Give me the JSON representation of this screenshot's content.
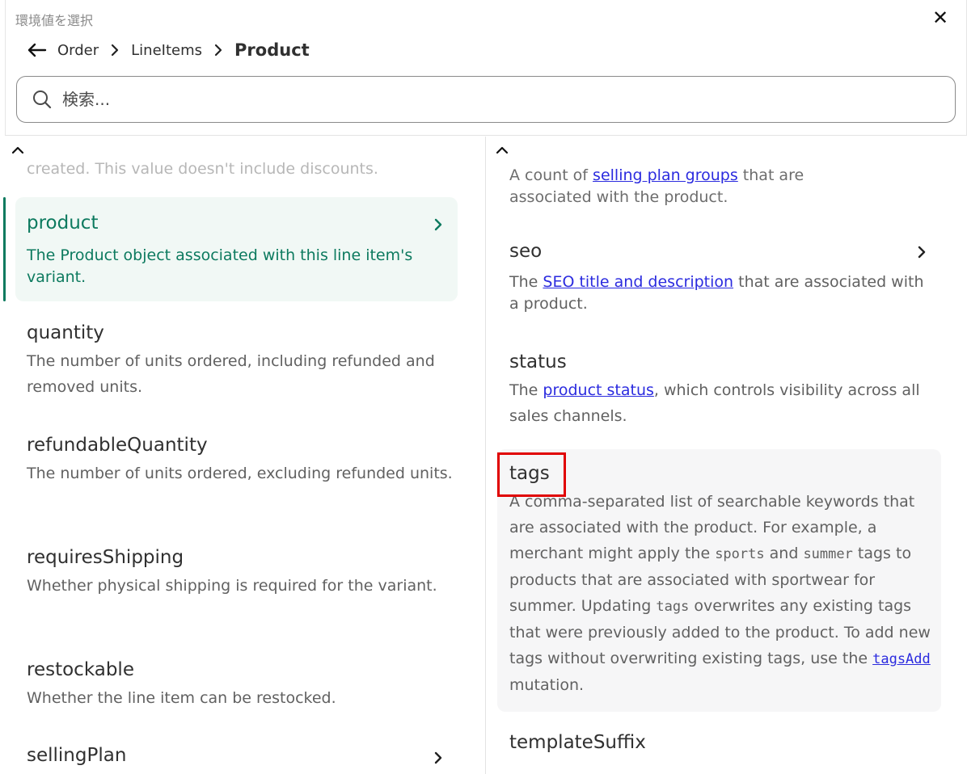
{
  "dialog": {
    "title": "環境値を選択",
    "close_label": "✕"
  },
  "breadcrumb": {
    "items": [
      "Order",
      "LineItems"
    ],
    "current": "Product"
  },
  "search": {
    "placeholder": "検索..."
  },
  "left": {
    "faded_top": "created. This value doesn't include discounts.",
    "items": [
      {
        "name": "product",
        "desc": "The Product object associated with this line item's variant.",
        "selected": true,
        "has_children": true
      },
      {
        "name": "quantity",
        "desc": "The number of units ordered, including refunded and removed units."
      },
      {
        "name": "refundableQuantity",
        "desc": "The number of units ordered, excluding refunded units."
      },
      {
        "name": "requiresShipping",
        "desc": "Whether physical shipping is required for the variant."
      },
      {
        "name": "restockable",
        "desc": "Whether the line item can be restocked."
      },
      {
        "name": "sellingPlan",
        "desc": "",
        "has_children": true
      }
    ]
  },
  "right": {
    "faded_top": {
      "pre": "A count of ",
      "link": "selling plan groups",
      "post": " that are",
      "line2": "associated with the product."
    },
    "seo": {
      "name": "seo",
      "pre": "The ",
      "link": "SEO title and description",
      "post": " that are associated with a product."
    },
    "status": {
      "name": "status",
      "pre": "The ",
      "link": "product status",
      "post": ", which controls visibility across all sales channels."
    },
    "tags": {
      "name": "tags",
      "t1": "A comma-separated list of searchable keywords that are associated with the product. For example, a merchant might apply the ",
      "c1": "sports",
      "t2": " and ",
      "c2": "summer",
      "t3": " tags to products that are associated with sportwear for summer. Updating ",
      "c3": "tags",
      "t4": " overwrites any existing tags that were previously added to the product. To add new tags without overwriting existing tags, use the ",
      "link": "tagsAdd",
      "t5": " mutation."
    },
    "templateSuffix": {
      "name": "templateSuffix"
    }
  },
  "colors": {
    "accent": "#0d7a5f",
    "link": "#2b2bdf",
    "highlight": "#e00000"
  }
}
